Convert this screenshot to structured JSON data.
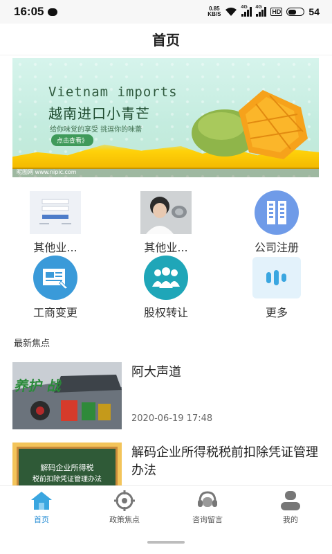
{
  "status_bar": {
    "time": "16:05",
    "net_speed_value": "0.85",
    "net_speed_unit": "KB/S",
    "signal_label_1": "4G",
    "signal_label_2": "4G",
    "hd_label": "HD",
    "battery_level": "54"
  },
  "header": {
    "title": "首页"
  },
  "banner": {
    "title_en": "Vietnam imports",
    "title_cn": "越南进口小青芒",
    "subtitle": "给你味觉的享受  挑逗你的味蕾",
    "button_label": "点击查看》",
    "watermark": "昵图网 www.nipic.com"
  },
  "grid": [
    {
      "label": "其他业...",
      "icon": "form-screenshot-thumbnail"
    },
    {
      "label": "其他业...",
      "icon": "person-photo-thumbnail"
    },
    {
      "label": "公司注册",
      "icon": "building-icon"
    },
    {
      "label": "工商变更",
      "icon": "document-edit-icon"
    },
    {
      "label": "股权转让",
      "icon": "people-group-icon"
    },
    {
      "label": "更多",
      "icon": "more-bars-icon"
    }
  ],
  "section": {
    "title": "最新焦点"
  },
  "news": [
    {
      "title": "阿大声道",
      "date": "2020-06-19 17:48",
      "thumb_text": "养护 战"
    },
    {
      "title": "解码企业所得税税前扣除凭证管理办法",
      "date": "",
      "thumb_text_1": "解码企业所得税",
      "thumb_text_2": "税前扣除凭证管理办法"
    }
  ],
  "tabs": [
    {
      "label": "首页",
      "icon": "home-icon",
      "active": true
    },
    {
      "label": "政策焦点",
      "icon": "target-icon",
      "active": false
    },
    {
      "label": "咨询留言",
      "icon": "headset-icon",
      "active": false
    },
    {
      "label": "我的",
      "icon": "user-icon",
      "active": false
    }
  ],
  "colors": {
    "accent": "#2b8fd6",
    "icon_blue": "#3a9ad9",
    "icon_teal": "#1fa6b8"
  }
}
